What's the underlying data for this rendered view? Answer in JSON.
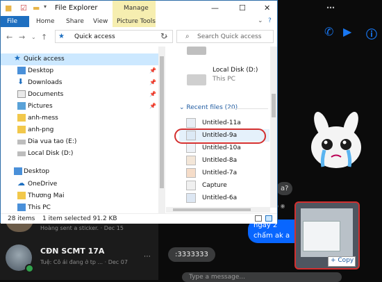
{
  "explorer": {
    "title": "File Explorer",
    "manage_tab": "Manage",
    "ribbon_tabs": {
      "file": "File",
      "home": "Home",
      "share": "Share",
      "view": "View",
      "picture_tools": "Picture Tools"
    },
    "address": "Quick access",
    "search_placeholder": "Search Quick access",
    "nav": {
      "quick_access": "Quick access",
      "items": [
        "Desktop",
        "Downloads",
        "Documents",
        "Pictures",
        "anh-mess",
        "anh-png",
        "Dia vua tao (E:)",
        "Local Disk (D:)"
      ],
      "desktop": "Desktop",
      "onedrive": "OneDrive",
      "user": "Thương Mai",
      "this_pc": "This PC"
    },
    "content": {
      "disk_name": "Local Disk (D:)",
      "disk_sub": "This PC",
      "recent_header": "Recent files (20)",
      "files": [
        "Untitled-11a",
        "Untitled-9a",
        "Untitled-10a",
        "Untitled-8a",
        "Untitled-7a",
        "Capture",
        "Untitled-6a"
      ]
    },
    "status": {
      "items": "28 items",
      "selected": "1 item selected  91.2 KB"
    }
  },
  "messenger": {
    "prev_text": "Hoàng sent a sticker. · Dec 15",
    "conv_name": "CĐN SCMT 17A",
    "conv_sub": "Tuệ: Cô ái đang ở tp ... · Dec 07",
    "left_bubble": ":3333333",
    "right_bubble_l1": "ngày 2",
    "right_bubble_l2": "chấm ak a",
    "partial": "a?",
    "input_placeholder": "Type a message...",
    "copy_label": "+ Copy"
  }
}
